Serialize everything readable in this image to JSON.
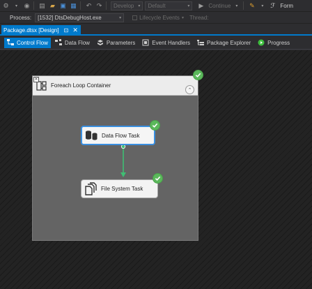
{
  "toolbar": {
    "solution_config": "Develop",
    "solution_platform": "Default",
    "continue_label": "Continue",
    "form_label": "Form"
  },
  "process": {
    "label": "Process:",
    "value": "[1532] DtsDebugHost.exe",
    "lifecycle_label": "Lifecycle Events",
    "thread_label": "Thread:"
  },
  "document_tab": {
    "title": "Package.dtsx [Design]",
    "pin": "⊡",
    "close": "✕"
  },
  "designer_tabs": [
    {
      "label": "Control Flow",
      "icon": "control-flow-icon",
      "active": true
    },
    {
      "label": "Data Flow",
      "icon": "data-flow-icon",
      "active": false
    },
    {
      "label": "Parameters",
      "icon": "parameters-icon",
      "active": false
    },
    {
      "label": "Event Handlers",
      "icon": "event-handlers-icon",
      "active": false
    },
    {
      "label": "Package Explorer",
      "icon": "package-explorer-icon",
      "active": false
    },
    {
      "label": "Progress",
      "icon": "progress-icon",
      "active": false
    }
  ],
  "canvas": {
    "container": {
      "title": "Foreach Loop Container",
      "status": "success",
      "collapse_glyph": "⌃"
    },
    "tasks": [
      {
        "label": "Data Flow Task",
        "status": "success",
        "selected": true
      },
      {
        "label": "File System Task",
        "status": "success",
        "selected": false
      }
    ]
  },
  "colors": {
    "accent": "#007acc",
    "success": "#5bb85b",
    "selection": "#3a8fe0",
    "connector": "#3fbf73"
  }
}
